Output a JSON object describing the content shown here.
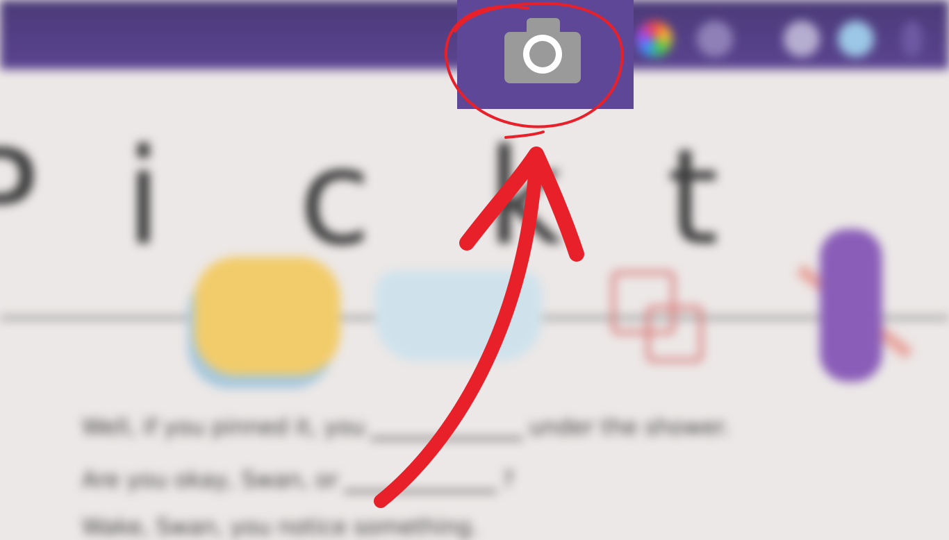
{
  "toolbar": {
    "icons": [
      "color-wheel-icon",
      "chat-icon",
      "grid-icon",
      "avatar-icon",
      "more-icon"
    ],
    "camera_icon": "camera-icon"
  },
  "worksheet": {
    "letters": [
      "P",
      "i",
      "c",
      "k",
      "t"
    ],
    "sentences": [
      {
        "before": "Well, if you pinned it, you",
        "after": "under the shower."
      },
      {
        "before": "Are you okay, Swan, or",
        "after": "?"
      },
      {
        "before": "Wake, Swan, you notice something."
      }
    ]
  },
  "annotation": {
    "color": "#e8202a",
    "shape": "circle-with-arrow"
  },
  "colors": {
    "topbar": "#5b4490",
    "background": "#ece8e7",
    "accent": "#e8202a"
  }
}
